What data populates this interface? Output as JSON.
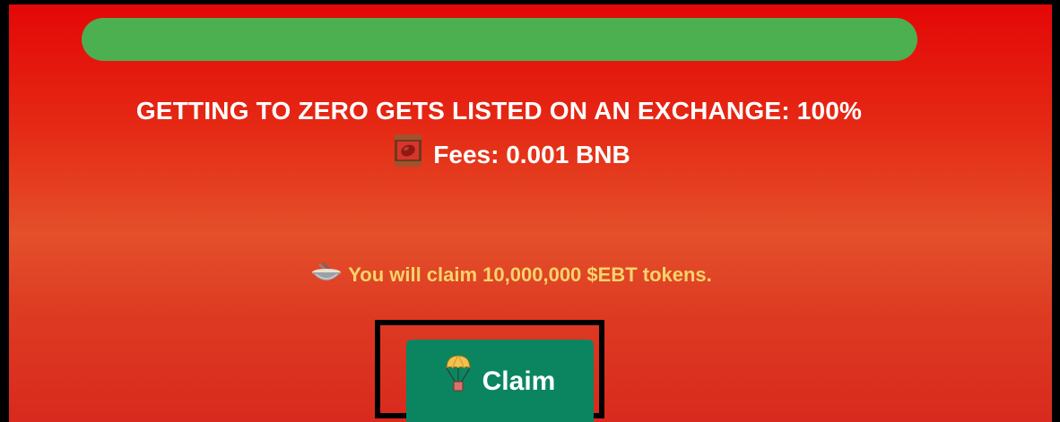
{
  "progress": {
    "fraction": 1.0,
    "color": "#4caf50"
  },
  "status": {
    "text": "GETTING TO ZERO GETS LISTED ON AN EXCHANGE: 100%"
  },
  "fees": {
    "icon": "bean-can-icon",
    "text": "Fees: 0.001 BNB"
  },
  "claim_info": {
    "icon": "bowl-icon",
    "text": "You will claim 10,000,000 $EBT tokens."
  },
  "claim_button": {
    "icon": "parachute-icon",
    "label": "Claim",
    "color": "#0a8560"
  },
  "colors": {
    "background_top": "#e40707",
    "background_mid": "#e4502a",
    "info_text": "#f7d36a"
  }
}
